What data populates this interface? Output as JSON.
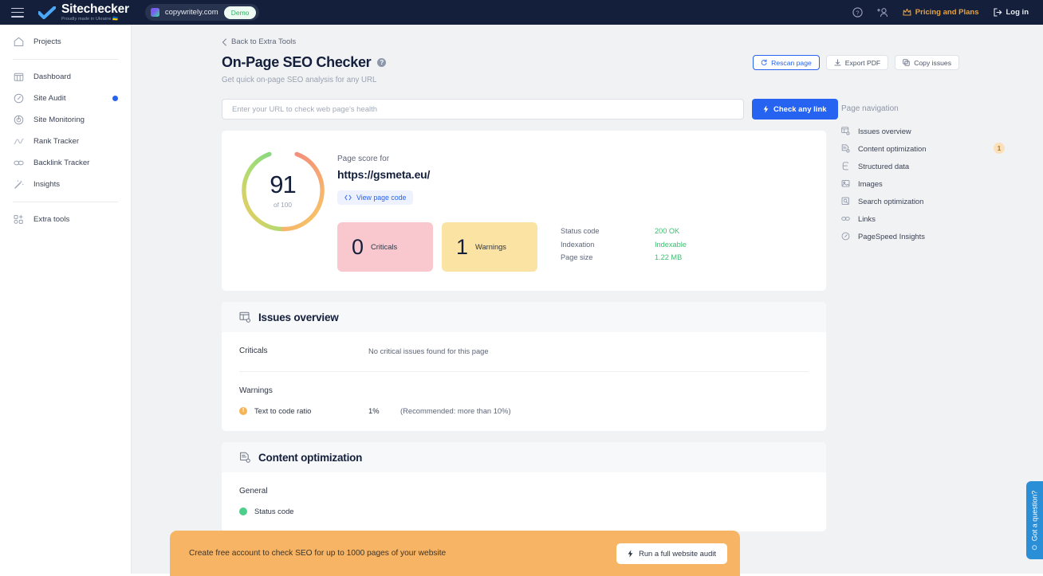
{
  "topbar": {
    "menu_icon": "hamburger-menu-icon",
    "brand": {
      "name": "Sitechecker",
      "tagline": "Proudly made in Ukraine 🇺🇦"
    },
    "domain": {
      "name": "copywritely.com",
      "badge": "Demo"
    },
    "help_icon": "help-circle-icon",
    "invite_icon": "add-user-icon",
    "pricing_label": "Pricing and Plans",
    "login_label": "Log in"
  },
  "sidebar": {
    "groups": [
      {
        "items": [
          {
            "label": "Projects",
            "icon": "home-icon",
            "active": false
          }
        ]
      },
      {
        "items": [
          {
            "label": "Dashboard",
            "icon": "dashboard-icon",
            "active": false
          },
          {
            "label": "Site Audit",
            "icon": "gauge-icon",
            "active": true
          },
          {
            "label": "Site Monitoring",
            "icon": "target-icon",
            "active": false
          },
          {
            "label": "Rank Tracker",
            "icon": "chart-line-icon",
            "active": false
          },
          {
            "label": "Backlink Tracker",
            "icon": "link-icon",
            "active": false
          },
          {
            "label": "Insights",
            "icon": "magic-wand-icon",
            "active": false
          }
        ]
      },
      {
        "items": [
          {
            "label": "Extra tools",
            "icon": "grid-plus-icon",
            "active": false
          }
        ]
      }
    ]
  },
  "main": {
    "back_label": "Back to Extra Tools",
    "title": "On-Page SEO Checker",
    "subtitle": "Get quick on-page SEO analysis for any URL",
    "actions": [
      {
        "label": "Rescan page",
        "icon": "refresh-icon",
        "primary": true
      },
      {
        "label": "Export PDF",
        "icon": "export-pdf-icon",
        "primary": false
      },
      {
        "label": "Copy issues",
        "icon": "copy-icon",
        "primary": false
      }
    ],
    "url_form": {
      "placeholder": "Enter your URL to check web page's health",
      "value": "",
      "button_label": "Check any link",
      "button_icon": "lightning-icon"
    },
    "score": {
      "value": "91",
      "of_label": "of 100",
      "max": 100,
      "label": "Page score for",
      "url": "https://gsmeta.eu/",
      "view_code_label": "View page code",
      "view_code_icon": "code-icon",
      "gauge_colors": {
        "start": "#62d07f",
        "mid": "#f6c15b",
        "end": "#f4887e"
      }
    },
    "stats": {
      "criticals": {
        "count": "0",
        "label": "Criticals",
        "color": "#f9c8cf"
      },
      "warnings": {
        "count": "1",
        "label": "Warnings",
        "color": "#fbe3a4"
      },
      "meta": [
        {
          "key": "Status code",
          "value": "200 OK"
        },
        {
          "key": "Indexation",
          "value": "Indexable"
        },
        {
          "key": "Page size",
          "value": "1.22 MB"
        }
      ]
    },
    "sections": [
      {
        "title": "Issues overview",
        "icon": "issues-overview-icon",
        "blocks": [
          {
            "label": "Criticals",
            "empty_text": "No critical issues found for this page",
            "rows": []
          },
          {
            "label": "Warnings",
            "empty_text": "",
            "rows": [
              {
                "name": "Text to code ratio",
                "status": "warning",
                "value": "1%",
                "note": "(Recommended: more than 10%)"
              }
            ]
          }
        ]
      },
      {
        "title": "Content optimization",
        "icon": "content-optimization-icon",
        "blocks": [
          {
            "label": "General",
            "empty_text": "",
            "rows": [
              {
                "name": "Status code",
                "status": "ok",
                "value": "",
                "note": ""
              }
            ]
          }
        ]
      }
    ]
  },
  "page_navigation": {
    "title": "Page navigation",
    "items": [
      {
        "label": "Issues overview",
        "icon": "issues-overview-icon",
        "badge": ""
      },
      {
        "label": "Content optimization",
        "icon": "content-optimization-icon",
        "badge": "1"
      },
      {
        "label": "Structured data",
        "icon": "structured-data-icon",
        "badge": ""
      },
      {
        "label": "Images",
        "icon": "image-icon",
        "badge": ""
      },
      {
        "label": "Search optimization",
        "icon": "search-optimization-icon",
        "badge": ""
      },
      {
        "label": "Links",
        "icon": "links-icon",
        "badge": ""
      },
      {
        "label": "PageSpeed Insights",
        "icon": "pagespeed-icon",
        "badge": ""
      }
    ]
  },
  "banner": {
    "text": "Create free account to check SEO for up to 1000 pages of your website",
    "button_label": "Run a full website audit",
    "button_icon": "lightning-icon",
    "color": "#f8b465"
  },
  "chat_tab": {
    "label": "Got a question?",
    "color": "#2a8fd6"
  }
}
